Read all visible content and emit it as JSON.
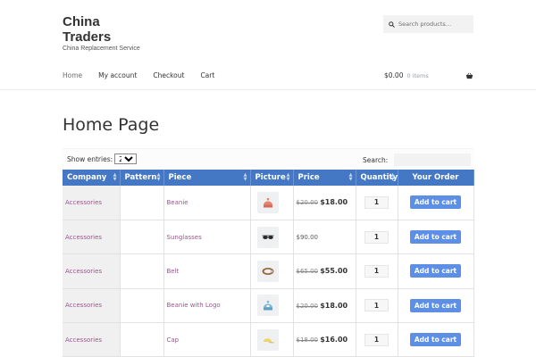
{
  "site": {
    "title": "China Traders",
    "tagline": "China Replacement Service"
  },
  "search": {
    "placeholder": "Search products…"
  },
  "nav": {
    "items": [
      {
        "label": "Home"
      },
      {
        "label": "My account"
      },
      {
        "label": "Checkout"
      },
      {
        "label": "Cart"
      }
    ]
  },
  "cart": {
    "amount": "$0.00",
    "count": "0 items"
  },
  "page": {
    "title": "Home Page"
  },
  "table_controls": {
    "show_label": "Show entries:",
    "entries_value": "25",
    "search_label": "Search:"
  },
  "table": {
    "columns": [
      "Company",
      "Pattern",
      "Piece",
      "Picture",
      "Price",
      "Quantity",
      "Your Order"
    ],
    "rows": [
      {
        "company": "Accessories",
        "pattern": "",
        "piece": "Beanie",
        "picture_icon": "beanie-icon",
        "old_price": "$20.00",
        "price": "$18.00",
        "quantity": "1",
        "button": "Add to cart"
      },
      {
        "company": "Accessories",
        "pattern": "",
        "piece": "Sunglasses",
        "picture_icon": "sunglasses-icon",
        "old_price": "",
        "price": "$90.00",
        "quantity": "1",
        "button": "Add to cart"
      },
      {
        "company": "Accessories",
        "pattern": "",
        "piece": "Belt",
        "picture_icon": "belt-icon",
        "old_price": "$65.00",
        "price": "$55.00",
        "quantity": "1",
        "button": "Add to cart"
      },
      {
        "company": "Accessories",
        "pattern": "",
        "piece": "Beanie with Logo",
        "picture_icon": "beanie-logo-icon",
        "old_price": "$20.00",
        "price": "$18.00",
        "quantity": "1",
        "button": "Add to cart"
      },
      {
        "company": "Accessories",
        "pattern": "",
        "piece": "Cap",
        "picture_icon": "cap-icon",
        "old_price": "$18.00",
        "price": "$16.00",
        "quantity": "1",
        "button": "Add to cart"
      }
    ]
  },
  "colors": {
    "header_blue": "#4477c4",
    "button_blue": "#5c8fe5",
    "link_purple": "#96588a"
  }
}
